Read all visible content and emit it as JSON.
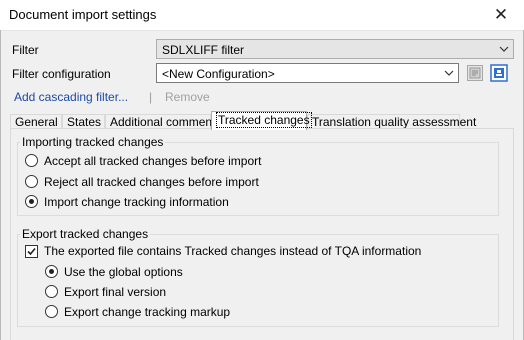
{
  "window": {
    "title": "Document import settings",
    "close_glyph": "✕"
  },
  "filter": {
    "label": "Filter",
    "value": "SDLXLIFF filter"
  },
  "filter_config": {
    "label": "Filter configuration",
    "value": "<New Configuration>"
  },
  "links": {
    "add_cascading": "Add cascading filter...",
    "separator": "|",
    "remove": "Remove"
  },
  "tabs": [
    {
      "label": "General"
    },
    {
      "label": "States"
    },
    {
      "label": "Additional comments"
    },
    {
      "label": "Tracked changes"
    },
    {
      "label": "Translation quality assessment"
    }
  ],
  "selected_tab": "Tracked changes",
  "importing": {
    "title": "Importing tracked changes",
    "options": [
      {
        "label": "Accept all tracked changes before import",
        "selected": false
      },
      {
        "label": "Reject all tracked changes before import",
        "selected": false
      },
      {
        "label": "Import change tracking information",
        "selected": true
      }
    ]
  },
  "export": {
    "title": "Export tracked changes",
    "checkbox_label": "The exported file contains Tracked changes instead of TQA information",
    "checkbox_checked": true,
    "options": [
      {
        "label": "Use the global options",
        "selected": true
      },
      {
        "label": "Export final version",
        "selected": false
      },
      {
        "label": "Export change tracking markup",
        "selected": false
      }
    ]
  },
  "icons": {
    "settings": "filter-settings-icon",
    "edit": "edit-configuration-icon"
  },
  "colors": {
    "link": "#1c4aa6",
    "icon_blue": "#2f6fd0",
    "disabled": "#a0a0a0"
  }
}
